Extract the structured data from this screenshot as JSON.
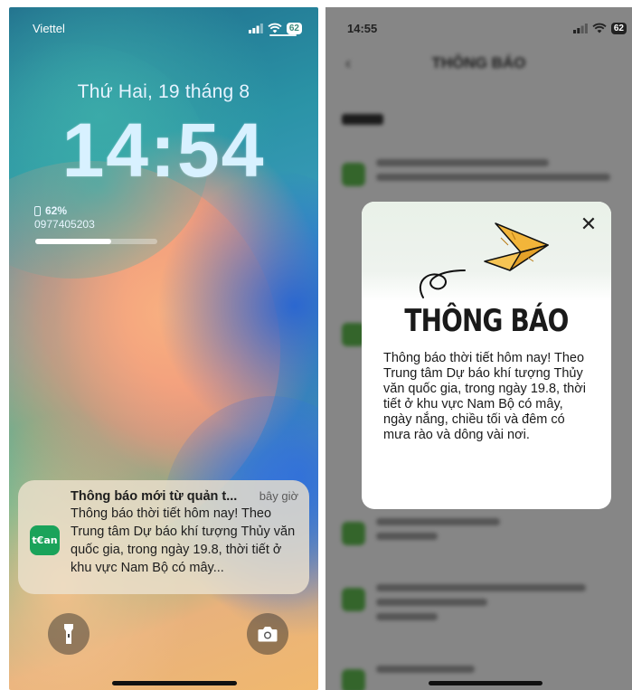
{
  "lock_screen": {
    "carrier": "Viettel",
    "battery_level": "62",
    "date": "Thứ Hai, 19 tháng 8",
    "time": "14:54",
    "widget": {
      "battery_percent": "62%",
      "phone_number": "0977405203",
      "battery_fraction": 0.62
    },
    "notification": {
      "app_icon_label": "t€an",
      "title": "Thông báo mới từ quản t...",
      "time": "bây giờ",
      "body": "Thông báo thời tiết hôm nay! Theo Trung tâm Dự báo khí tượng Thủy văn quốc gia, trong ngày 19.8, thời tiết ở khu vực Nam Bộ có mây..."
    },
    "buttons": {
      "left_icon": "flashlight-icon",
      "right_icon": "camera-icon"
    }
  },
  "app_screen": {
    "time": "14:55",
    "battery_level": "62",
    "header_title": "THÔNG BÁO",
    "modal": {
      "title": "THÔNG BÁO",
      "body": "Thông báo thời tiết hôm nay! Theo Trung tâm Dự báo khí tượng Thủy văn quốc gia, trong ngày 19.8, thời tiết ở khu vực Nam Bộ có mây, ngày nắng, chiều tối và đêm có mưa rào và dông vài nơi.",
      "close_icon": "close-icon",
      "illustration": "paper-plane-icon"
    }
  },
  "colors": {
    "notification_icon_bg": "#1aa35a",
    "overlay": "rgba(0,0,0,0.45)"
  }
}
